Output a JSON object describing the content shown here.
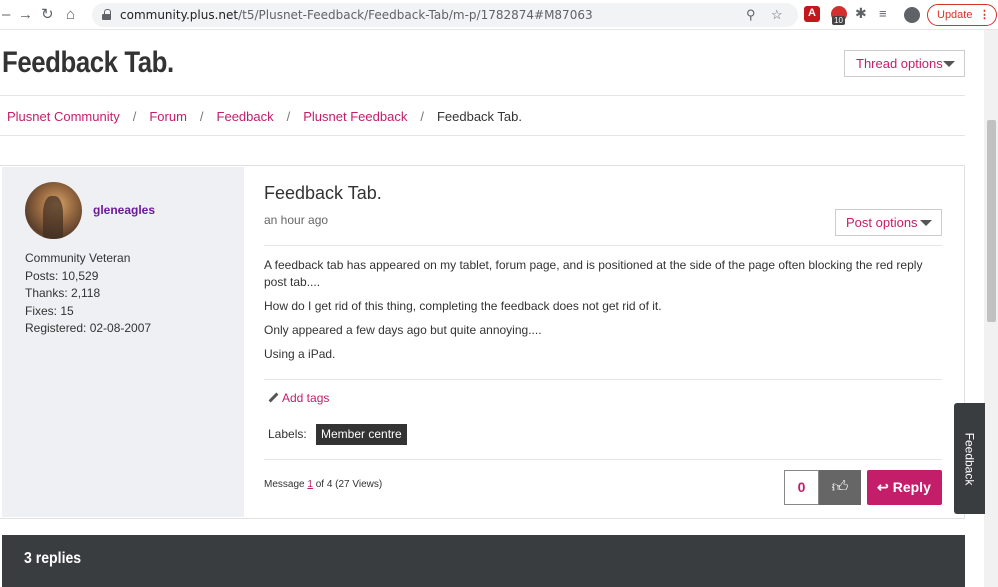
{
  "browser": {
    "url_domain": "community.plus.net",
    "url_path": "/t5/Plusnet-Feedback/Feedback-Tab/m-p/1782874#M87063",
    "ext_badge": "10",
    "update_label": "Update"
  },
  "page": {
    "title": "Feedback Tab.",
    "thread_options": "Thread options"
  },
  "breadcrumb": [
    "Plusnet Community",
    "Forum",
    "Feedback",
    "Plusnet Feedback",
    "Feedback Tab."
  ],
  "breadcrumb_sep": "/",
  "author": {
    "username": "gleneagles",
    "rank": "Community Veteran",
    "posts": "Posts: 10,529",
    "thanks": "Thanks: 2,118",
    "fixes": "Fixes: 15",
    "registered": "Registered: 02-08-2007"
  },
  "post": {
    "title": "Feedback Tab.",
    "time": "an hour ago",
    "post_options": "Post options",
    "body": [
      "A feedback tab has appeared on my tablet, forum page, and is positioned at the side of the page often blocking the red reply post tab....",
      "How do I get rid of this thing, completing the feedback does not get rid of it.",
      "Only appeared a few days ago but quite annoying....",
      "Using a iPad."
    ],
    "add_tags": "Add tags",
    "labels_label": "Labels:",
    "label_chip": "Member centre",
    "meta_prefix": "Message ",
    "meta_num": "1",
    "meta_suffix": " of 4 (27 Views)",
    "kudos_count": "0",
    "reply_label": "Reply"
  },
  "feedback_tab": "Feedback",
  "replies": "3 replies",
  "colors": {
    "accent": "#c41e6b",
    "username": "#6a1b9a",
    "dark_bar": "#3a3d40"
  }
}
